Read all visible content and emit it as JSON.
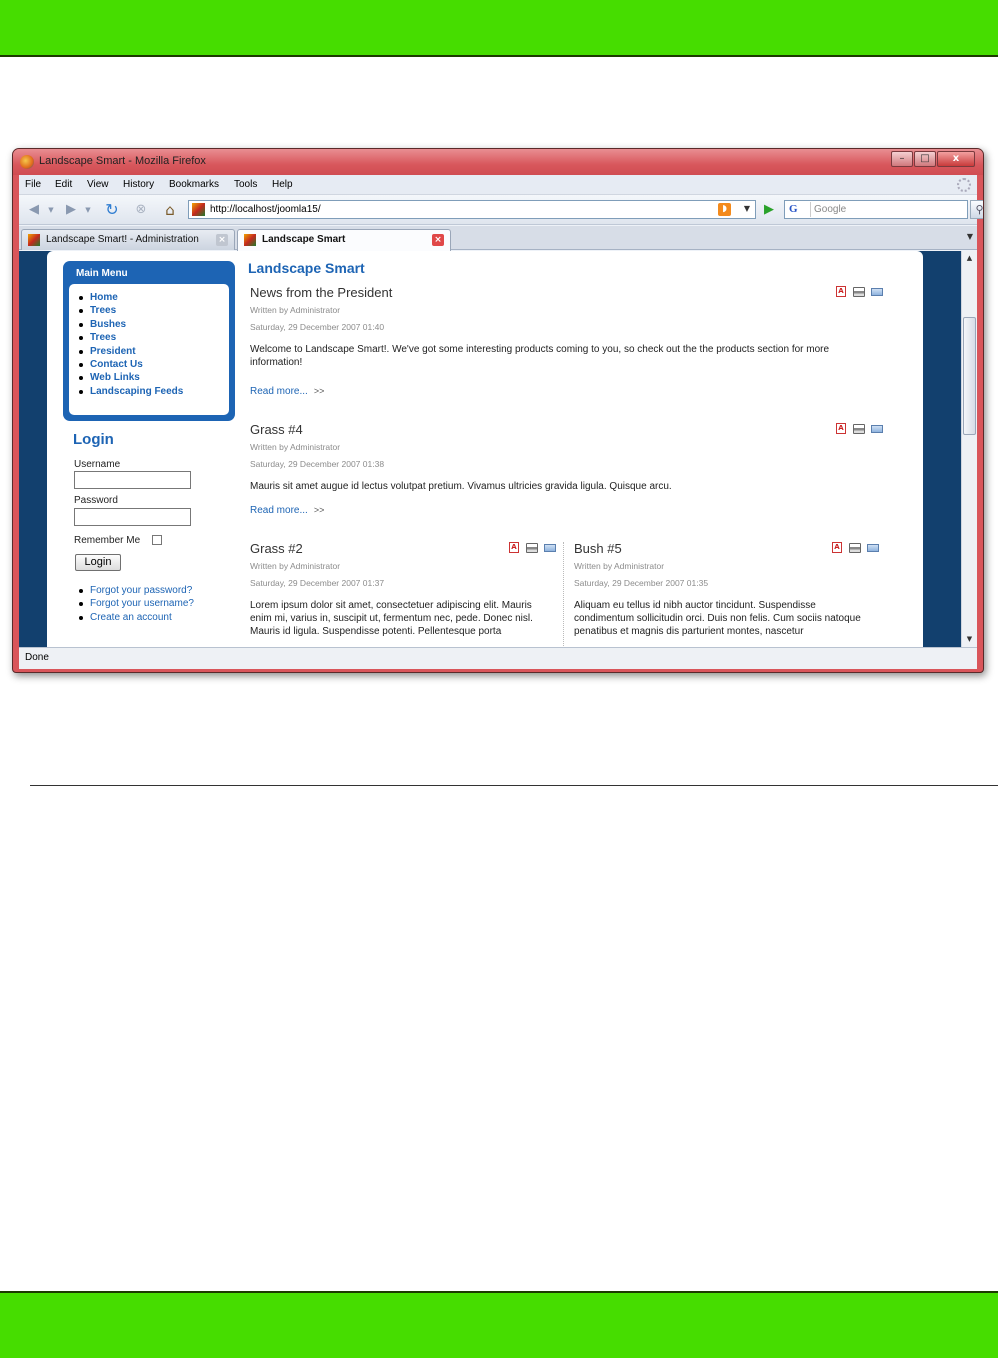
{
  "browser": {
    "window_title": "Landscape Smart - Mozilla Firefox",
    "menu": [
      "File",
      "Edit",
      "View",
      "History",
      "Bookmarks",
      "Tools",
      "Help"
    ],
    "url": "http://localhost/joomla15/",
    "search_engine": "G",
    "search_placeholder": "Google",
    "tabs": [
      {
        "label": "Landscape Smart! - Administration",
        "active": false
      },
      {
        "label": "Landscape Smart",
        "active": true
      }
    ],
    "status": "Done",
    "window_buttons": {
      "minimize": "–",
      "maximize": "□",
      "close": "x"
    }
  },
  "site": {
    "title": "Landscape Smart",
    "main_menu": {
      "title": "Main Menu",
      "items": [
        "Home",
        "Trees",
        "Bushes",
        "Trees",
        "President",
        "Contact Us",
        "Web Links",
        "Landscaping Feeds"
      ]
    },
    "login": {
      "title": "Login",
      "username_label": "Username",
      "password_label": "Password",
      "remember_label": "Remember Me",
      "button": "Login",
      "links": [
        "Forgot your password?",
        "Forgot your username?",
        "Create an account"
      ]
    },
    "articles": [
      {
        "title": "News from the President",
        "author": "Written by Administrator",
        "date": "Saturday, 29 December 2007 01:40",
        "body": "Welcome to Landscape Smart!. We've got some interesting products coming to you, so check out the the products section for more information!",
        "read_more": "Read more...",
        "read_more_arrows": ">>"
      },
      {
        "title": "Grass #4",
        "author": "Written by Administrator",
        "date": "Saturday, 29 December 2007 01:38",
        "body": "Mauris sit amet augue id lectus volutpat pretium. Vivamus ultricies gravida ligula. Quisque arcu.",
        "read_more": "Read more...",
        "read_more_arrows": ">>"
      },
      {
        "title": "Grass #2",
        "author": "Written by Administrator",
        "date": "Saturday, 29 December 2007 01:37",
        "body": "Lorem ipsum dolor sit amet, consectetuer adipiscing elit. Mauris enim mi, varius in, suscipit ut, fermentum nec, pede. Donec nisl. Mauris id ligula. Suspendisse potenti. Pellentesque porta"
      },
      {
        "title": "Bush #5",
        "author": "Written by Administrator",
        "date": "Saturday, 29 December 2007 01:35",
        "body": "Aliquam eu tellus id nibh auctor tincidunt. Suspendisse condimentum sollicitudin orci. Duis non felis. Cum sociis natoque penatibus et magnis dis parturient montes, nascetur"
      }
    ],
    "icon_names": [
      "pdf-icon",
      "print-icon",
      "email-icon"
    ]
  },
  "colors": {
    "band": "#46dd00",
    "link": "#1d64b4",
    "site_background": "#12406e",
    "window_frame": "#d9555a"
  }
}
